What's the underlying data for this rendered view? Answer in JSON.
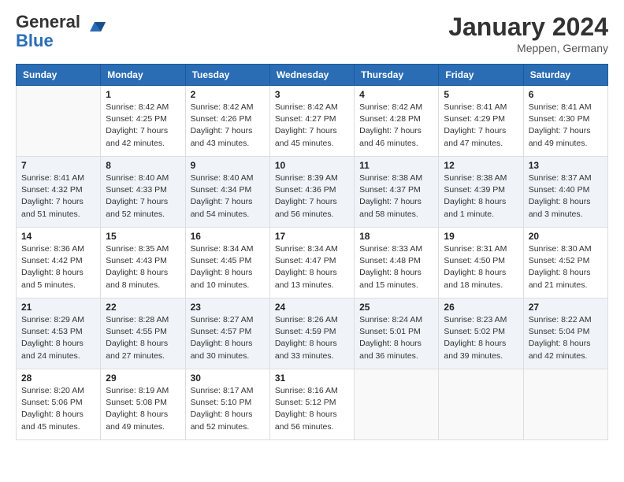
{
  "header": {
    "logo_general": "General",
    "logo_blue": "Blue",
    "month_title": "January 2024",
    "subtitle": "Meppen, Germany"
  },
  "days_of_week": [
    "Sunday",
    "Monday",
    "Tuesday",
    "Wednesday",
    "Thursday",
    "Friday",
    "Saturday"
  ],
  "weeks": [
    [
      {
        "day": "",
        "sunrise": "",
        "sunset": "",
        "daylight": ""
      },
      {
        "day": "1",
        "sunrise": "Sunrise: 8:42 AM",
        "sunset": "Sunset: 4:25 PM",
        "daylight": "Daylight: 7 hours and 42 minutes."
      },
      {
        "day": "2",
        "sunrise": "Sunrise: 8:42 AM",
        "sunset": "Sunset: 4:26 PM",
        "daylight": "Daylight: 7 hours and 43 minutes."
      },
      {
        "day": "3",
        "sunrise": "Sunrise: 8:42 AM",
        "sunset": "Sunset: 4:27 PM",
        "daylight": "Daylight: 7 hours and 45 minutes."
      },
      {
        "day": "4",
        "sunrise": "Sunrise: 8:42 AM",
        "sunset": "Sunset: 4:28 PM",
        "daylight": "Daylight: 7 hours and 46 minutes."
      },
      {
        "day": "5",
        "sunrise": "Sunrise: 8:41 AM",
        "sunset": "Sunset: 4:29 PM",
        "daylight": "Daylight: 7 hours and 47 minutes."
      },
      {
        "day": "6",
        "sunrise": "Sunrise: 8:41 AM",
        "sunset": "Sunset: 4:30 PM",
        "daylight": "Daylight: 7 hours and 49 minutes."
      }
    ],
    [
      {
        "day": "7",
        "sunrise": "Sunrise: 8:41 AM",
        "sunset": "Sunset: 4:32 PM",
        "daylight": "Daylight: 7 hours and 51 minutes."
      },
      {
        "day": "8",
        "sunrise": "Sunrise: 8:40 AM",
        "sunset": "Sunset: 4:33 PM",
        "daylight": "Daylight: 7 hours and 52 minutes."
      },
      {
        "day": "9",
        "sunrise": "Sunrise: 8:40 AM",
        "sunset": "Sunset: 4:34 PM",
        "daylight": "Daylight: 7 hours and 54 minutes."
      },
      {
        "day": "10",
        "sunrise": "Sunrise: 8:39 AM",
        "sunset": "Sunset: 4:36 PM",
        "daylight": "Daylight: 7 hours and 56 minutes."
      },
      {
        "day": "11",
        "sunrise": "Sunrise: 8:38 AM",
        "sunset": "Sunset: 4:37 PM",
        "daylight": "Daylight: 7 hours and 58 minutes."
      },
      {
        "day": "12",
        "sunrise": "Sunrise: 8:38 AM",
        "sunset": "Sunset: 4:39 PM",
        "daylight": "Daylight: 8 hours and 1 minute."
      },
      {
        "day": "13",
        "sunrise": "Sunrise: 8:37 AM",
        "sunset": "Sunset: 4:40 PM",
        "daylight": "Daylight: 8 hours and 3 minutes."
      }
    ],
    [
      {
        "day": "14",
        "sunrise": "Sunrise: 8:36 AM",
        "sunset": "Sunset: 4:42 PM",
        "daylight": "Daylight: 8 hours and 5 minutes."
      },
      {
        "day": "15",
        "sunrise": "Sunrise: 8:35 AM",
        "sunset": "Sunset: 4:43 PM",
        "daylight": "Daylight: 8 hours and 8 minutes."
      },
      {
        "day": "16",
        "sunrise": "Sunrise: 8:34 AM",
        "sunset": "Sunset: 4:45 PM",
        "daylight": "Daylight: 8 hours and 10 minutes."
      },
      {
        "day": "17",
        "sunrise": "Sunrise: 8:34 AM",
        "sunset": "Sunset: 4:47 PM",
        "daylight": "Daylight: 8 hours and 13 minutes."
      },
      {
        "day": "18",
        "sunrise": "Sunrise: 8:33 AM",
        "sunset": "Sunset: 4:48 PM",
        "daylight": "Daylight: 8 hours and 15 minutes."
      },
      {
        "day": "19",
        "sunrise": "Sunrise: 8:31 AM",
        "sunset": "Sunset: 4:50 PM",
        "daylight": "Daylight: 8 hours and 18 minutes."
      },
      {
        "day": "20",
        "sunrise": "Sunrise: 8:30 AM",
        "sunset": "Sunset: 4:52 PM",
        "daylight": "Daylight: 8 hours and 21 minutes."
      }
    ],
    [
      {
        "day": "21",
        "sunrise": "Sunrise: 8:29 AM",
        "sunset": "Sunset: 4:53 PM",
        "daylight": "Daylight: 8 hours and 24 minutes."
      },
      {
        "day": "22",
        "sunrise": "Sunrise: 8:28 AM",
        "sunset": "Sunset: 4:55 PM",
        "daylight": "Daylight: 8 hours and 27 minutes."
      },
      {
        "day": "23",
        "sunrise": "Sunrise: 8:27 AM",
        "sunset": "Sunset: 4:57 PM",
        "daylight": "Daylight: 8 hours and 30 minutes."
      },
      {
        "day": "24",
        "sunrise": "Sunrise: 8:26 AM",
        "sunset": "Sunset: 4:59 PM",
        "daylight": "Daylight: 8 hours and 33 minutes."
      },
      {
        "day": "25",
        "sunrise": "Sunrise: 8:24 AM",
        "sunset": "Sunset: 5:01 PM",
        "daylight": "Daylight: 8 hours and 36 minutes."
      },
      {
        "day": "26",
        "sunrise": "Sunrise: 8:23 AM",
        "sunset": "Sunset: 5:02 PM",
        "daylight": "Daylight: 8 hours and 39 minutes."
      },
      {
        "day": "27",
        "sunrise": "Sunrise: 8:22 AM",
        "sunset": "Sunset: 5:04 PM",
        "daylight": "Daylight: 8 hours and 42 minutes."
      }
    ],
    [
      {
        "day": "28",
        "sunrise": "Sunrise: 8:20 AM",
        "sunset": "Sunset: 5:06 PM",
        "daylight": "Daylight: 8 hours and 45 minutes."
      },
      {
        "day": "29",
        "sunrise": "Sunrise: 8:19 AM",
        "sunset": "Sunset: 5:08 PM",
        "daylight": "Daylight: 8 hours and 49 minutes."
      },
      {
        "day": "30",
        "sunrise": "Sunrise: 8:17 AM",
        "sunset": "Sunset: 5:10 PM",
        "daylight": "Daylight: 8 hours and 52 minutes."
      },
      {
        "day": "31",
        "sunrise": "Sunrise: 8:16 AM",
        "sunset": "Sunset: 5:12 PM",
        "daylight": "Daylight: 8 hours and 56 minutes."
      },
      {
        "day": "",
        "sunrise": "",
        "sunset": "",
        "daylight": ""
      },
      {
        "day": "",
        "sunrise": "",
        "sunset": "",
        "daylight": ""
      },
      {
        "day": "",
        "sunrise": "",
        "sunset": "",
        "daylight": ""
      }
    ]
  ]
}
